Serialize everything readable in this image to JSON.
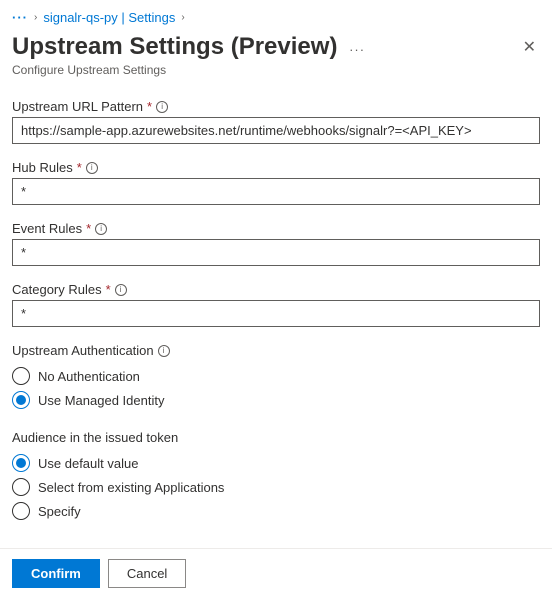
{
  "breadcrumb": {
    "ellipsis": "···",
    "link": "signalr-qs-py | Settings"
  },
  "header": {
    "title": "Upstream Settings (Preview)",
    "subtitle": "Configure Upstream Settings"
  },
  "fields": {
    "url": {
      "label": "Upstream URL Pattern",
      "value": "https://sample-app.azurewebsites.net/runtime/webhooks/signalr?=<API_KEY>"
    },
    "hub": {
      "label": "Hub Rules",
      "value": "*"
    },
    "event": {
      "label": "Event Rules",
      "value": "*"
    },
    "category": {
      "label": "Category Rules",
      "value": "*"
    }
  },
  "auth": {
    "label": "Upstream Authentication",
    "options": {
      "none": "No Authentication",
      "managed": "Use Managed Identity"
    },
    "selected": "managed"
  },
  "audience": {
    "label": "Audience in the issued token",
    "options": {
      "default": "Use default value",
      "select": "Select from existing Applications",
      "specify": "Specify"
    },
    "selected": "default"
  },
  "footer": {
    "confirm": "Confirm",
    "cancel": "Cancel"
  }
}
